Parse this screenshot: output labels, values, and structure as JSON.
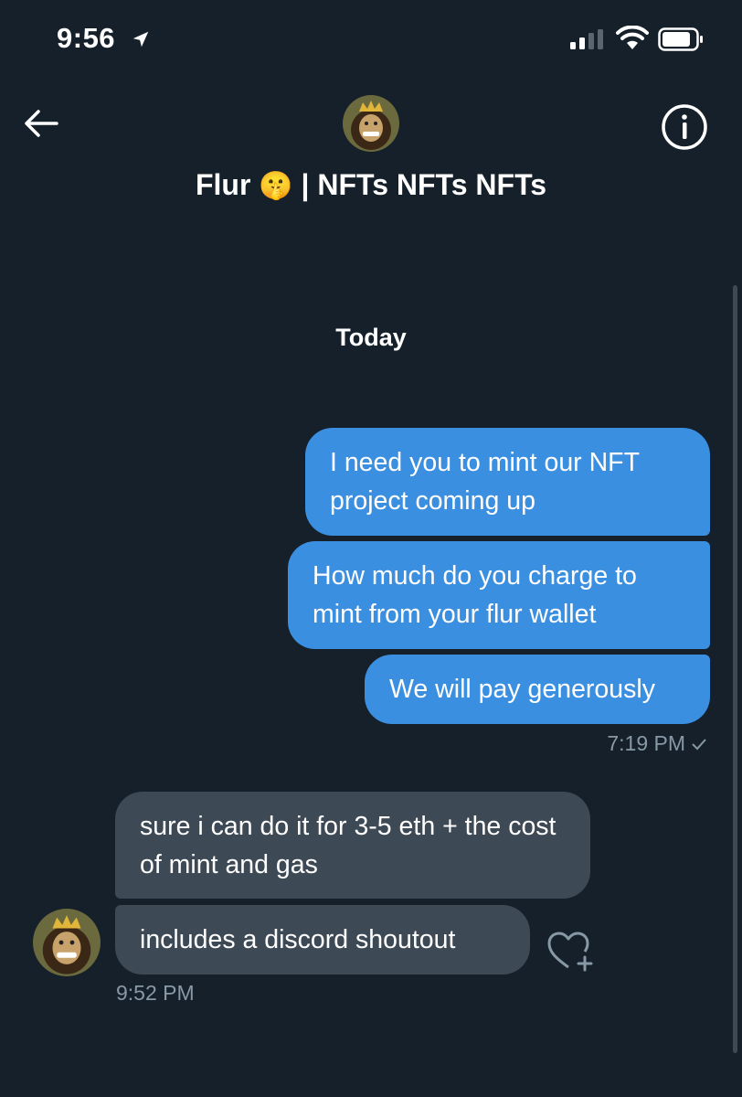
{
  "status_bar": {
    "time": "9:56"
  },
  "header": {
    "title_name": "Flur",
    "title_emoji": "🤫",
    "title_rest": "| NFTs NFTs NFTs"
  },
  "conversation": {
    "date_divider": "Today",
    "outgoing": [
      {
        "text": "I need you to mint our NFT project coming up"
      },
      {
        "text": "How much do you charge to mint from your flur wallet"
      },
      {
        "text": "We will pay generously"
      }
    ],
    "outgoing_time": "7:19 PM",
    "incoming": [
      {
        "text": "sure i can do it for 3-5 eth + the cost of mint and gas"
      },
      {
        "text": "includes a discord shoutout"
      }
    ],
    "incoming_time": "9:52 PM"
  },
  "colors": {
    "background": "#15202b",
    "outgoing_bubble": "#3b8fe0",
    "incoming_bubble": "#3d4955",
    "meta_text": "#8899a6"
  },
  "icons": [
    "location-arrow-icon",
    "signal-icon",
    "wifi-icon",
    "battery-icon",
    "back-arrow-icon",
    "info-icon",
    "heart-add-icon"
  ]
}
